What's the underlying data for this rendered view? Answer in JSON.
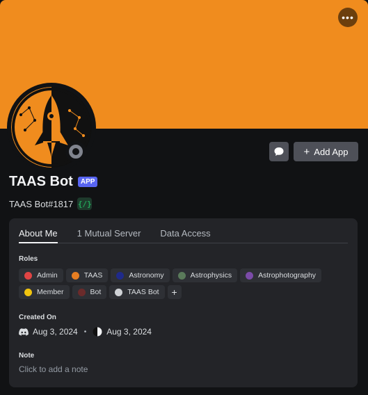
{
  "colors": {
    "banner": "#f08c1e",
    "app_badge": "#5865f2"
  },
  "header": {
    "more_icon": "ellipsis-icon",
    "message_icon": "chat-bubble-icon",
    "add_app_label": "Add App"
  },
  "profile": {
    "display_name": "TAAS Bot",
    "app_badge": "APP",
    "username": "TAAS Bot#1817",
    "status": "offline"
  },
  "tabs": [
    {
      "label": "About Me",
      "active": true
    },
    {
      "label": "1 Mutual Server",
      "active": false
    },
    {
      "label": "Data Access",
      "active": false
    }
  ],
  "roles_label": "Roles",
  "roles": [
    {
      "name": "Admin",
      "color": "#e04444"
    },
    {
      "name": "TAAS",
      "color": "#e67e22"
    },
    {
      "name": "Astronomy",
      "color": "#1f2a8a"
    },
    {
      "name": "Astrophysics",
      "color": "#5a7a5a"
    },
    {
      "name": "Astrophotography",
      "color": "#7b4ba8"
    },
    {
      "name": "Member",
      "color": "#f1c40f"
    },
    {
      "name": "Bot",
      "color": "#6b2b2b"
    },
    {
      "name": "TAAS Bot",
      "color": "#cfd2d6"
    }
  ],
  "created_on": {
    "label": "Created On",
    "discord_date": "Aug 3, 2024",
    "server_date": "Aug 3, 2024",
    "separator": "•"
  },
  "note": {
    "label": "Note",
    "placeholder": "Click to add a note"
  }
}
